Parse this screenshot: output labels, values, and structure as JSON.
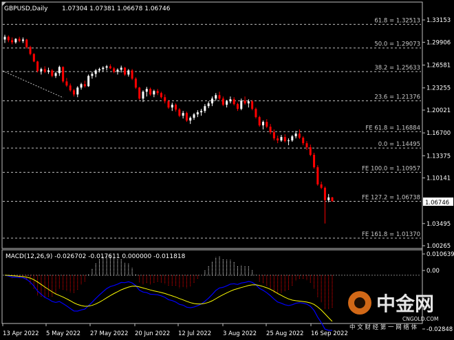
{
  "header": {
    "symbol": "GBPUSD,Daily",
    "ohlc": "1.07304 1.07381 1.06678 1.06746"
  },
  "price_axis": {
    "ticks": [
      "1.33153",
      "1.29906",
      "1.26581",
      "1.23255",
      "1.20021",
      "1.16700",
      "1.13375",
      "1.10141",
      "1.06746",
      "1.03495",
      "1.00265"
    ],
    "current": "1.06746"
  },
  "fib_levels": [
    {
      "label": "61.8 = 1.32513",
      "value": 1.32513
    },
    {
      "label": "50.0 = 1.29073",
      "value": 1.29073
    },
    {
      "label": "38.2 = 1.25633",
      "value": 1.25633
    },
    {
      "label": "23.6 = 1.21376",
      "value": 1.21376
    },
    {
      "label": "FE 61.8 = 1.16884",
      "value": 1.16884
    },
    {
      "label": "0.0 = 1.14495",
      "value": 1.14495
    },
    {
      "label": "FE 100.0 = 1.10957",
      "value": 1.10957
    },
    {
      "label": "FE 127.2 = 1.06738",
      "value": 1.06738
    },
    {
      "label": "FE 161.8 = 1.01370",
      "value": 1.0137
    }
  ],
  "macd": {
    "title": "MACD(12,26,9) -0.026702 -0.017611 0.000000 -0.011818",
    "axis_ticks": [
      "0.010639",
      "0.00",
      "-0.02848"
    ]
  },
  "time_axis": [
    "13 Apr 2022",
    "5 May 2022",
    "27 May 2022",
    "20 Jun 2022",
    "12 Jul 2022",
    "3 Aug 2022",
    "25 Aug 2022",
    "16 Sep 2022"
  ],
  "watermark": {
    "cn": "中金网",
    "url": "CNGOLD.COM",
    "sub": "中 文 财 经 第 一 网 络 体"
  },
  "colors": {
    "bull": "#ffffff",
    "bear": "#ff0000",
    "macd_line": "#0000ff",
    "signal_line": "#ffff00",
    "hist_pos": "#ffffff",
    "hist_neg": "#ff0000",
    "grid_dashed": "#c0c0c0"
  },
  "chart_data": {
    "type": "candlestick",
    "symbol": "GBPUSD",
    "timeframe": "Daily",
    "ylim": [
      1.00265,
      1.33153
    ],
    "x_labels": [
      "13 Apr 2022",
      "5 May 2022",
      "27 May 2022",
      "20 Jun 2022",
      "12 Jul 2022",
      "3 Aug 2022",
      "25 Aug 2022",
      "16 Sep 2022"
    ],
    "ohlc": [
      [
        1.303,
        1.31,
        1.298,
        1.307
      ],
      [
        1.307,
        1.309,
        1.299,
        1.302
      ],
      [
        1.302,
        1.306,
        1.296,
        1.299
      ],
      [
        1.299,
        1.305,
        1.297,
        1.304
      ],
      [
        1.304,
        1.307,
        1.299,
        1.301
      ],
      [
        1.301,
        1.306,
        1.298,
        1.303
      ],
      [
        1.303,
        1.304,
        1.29,
        1.292
      ],
      [
        1.292,
        1.294,
        1.28,
        1.282
      ],
      [
        1.282,
        1.283,
        1.27,
        1.271
      ],
      [
        1.271,
        1.272,
        1.255,
        1.257
      ],
      [
        1.257,
        1.262,
        1.252,
        1.26
      ],
      [
        1.26,
        1.264,
        1.254,
        1.256
      ],
      [
        1.256,
        1.262,
        1.253,
        1.258
      ],
      [
        1.258,
        1.26,
        1.248,
        1.25
      ],
      [
        1.25,
        1.256,
        1.247,
        1.254
      ],
      [
        1.254,
        1.265,
        1.25,
        1.263
      ],
      [
        1.263,
        1.264,
        1.24,
        1.242
      ],
      [
        1.242,
        1.247,
        1.234,
        1.236
      ],
      [
        1.236,
        1.239,
        1.227,
        1.229
      ],
      [
        1.229,
        1.231,
        1.22,
        1.223
      ],
      [
        1.223,
        1.235,
        1.219,
        1.233
      ],
      [
        1.233,
        1.24,
        1.23,
        1.238
      ],
      [
        1.238,
        1.243,
        1.233,
        1.235
      ],
      [
        1.235,
        1.252,
        1.234,
        1.25
      ],
      [
        1.25,
        1.256,
        1.246,
        1.253
      ],
      [
        1.253,
        1.26,
        1.248,
        1.258
      ],
      [
        1.258,
        1.262,
        1.255,
        1.26
      ],
      [
        1.26,
        1.264,
        1.256,
        1.262
      ],
      [
        1.262,
        1.266,
        1.258,
        1.264
      ],
      [
        1.264,
        1.267,
        1.26,
        1.261
      ],
      [
        1.261,
        1.263,
        1.254,
        1.256
      ],
      [
        1.256,
        1.261,
        1.252,
        1.259
      ],
      [
        1.259,
        1.265,
        1.255,
        1.262
      ],
      [
        1.262,
        1.263,
        1.25,
        1.252
      ],
      [
        1.252,
        1.26,
        1.249,
        1.258
      ],
      [
        1.258,
        1.26,
        1.244,
        1.246
      ],
      [
        1.246,
        1.248,
        1.231,
        1.233
      ],
      [
        1.233,
        1.234,
        1.215,
        1.217
      ],
      [
        1.217,
        1.229,
        1.212,
        1.227
      ],
      [
        1.227,
        1.234,
        1.22,
        1.231
      ],
      [
        1.231,
        1.233,
        1.221,
        1.223
      ],
      [
        1.223,
        1.23,
        1.219,
        1.228
      ],
      [
        1.228,
        1.231,
        1.222,
        1.225
      ],
      [
        1.225,
        1.227,
        1.217,
        1.219
      ],
      [
        1.219,
        1.223,
        1.21,
        1.213
      ],
      [
        1.213,
        1.215,
        1.202,
        1.204
      ],
      [
        1.204,
        1.211,
        1.199,
        1.208
      ],
      [
        1.208,
        1.21,
        1.198,
        1.201
      ],
      [
        1.201,
        1.203,
        1.19,
        1.192
      ],
      [
        1.192,
        1.199,
        1.188,
        1.196
      ],
      [
        1.196,
        1.198,
        1.183,
        1.185
      ],
      [
        1.185,
        1.191,
        1.18,
        1.189
      ],
      [
        1.189,
        1.196,
        1.186,
        1.194
      ],
      [
        1.194,
        1.2,
        1.19,
        1.197
      ],
      [
        1.197,
        1.202,
        1.192,
        1.199
      ],
      [
        1.199,
        1.209,
        1.196,
        1.206
      ],
      [
        1.206,
        1.213,
        1.203,
        1.21
      ],
      [
        1.21,
        1.22,
        1.206,
        1.217
      ],
      [
        1.217,
        1.225,
        1.214,
        1.222
      ],
      [
        1.222,
        1.227,
        1.215,
        1.217
      ],
      [
        1.217,
        1.22,
        1.206,
        1.208
      ],
      [
        1.208,
        1.215,
        1.204,
        1.213
      ],
      [
        1.213,
        1.22,
        1.21,
        1.216
      ],
      [
        1.216,
        1.219,
        1.207,
        1.209
      ],
      [
        1.209,
        1.211,
        1.199,
        1.202
      ],
      [
        1.202,
        1.217,
        1.2,
        1.214
      ],
      [
        1.214,
        1.22,
        1.208,
        1.21
      ],
      [
        1.21,
        1.216,
        1.204,
        1.213
      ],
      [
        1.213,
        1.215,
        1.2,
        1.202
      ],
      [
        1.202,
        1.204,
        1.188,
        1.19
      ],
      [
        1.19,
        1.192,
        1.176,
        1.178
      ],
      [
        1.178,
        1.185,
        1.172,
        1.183
      ],
      [
        1.183,
        1.187,
        1.174,
        1.176
      ],
      [
        1.176,
        1.18,
        1.165,
        1.168
      ],
      [
        1.168,
        1.172,
        1.156,
        1.159
      ],
      [
        1.159,
        1.163,
        1.152,
        1.156
      ],
      [
        1.156,
        1.164,
        1.154,
        1.161
      ],
      [
        1.161,
        1.165,
        1.153,
        1.155
      ],
      [
        1.155,
        1.159,
        1.149,
        1.156
      ],
      [
        1.156,
        1.164,
        1.154,
        1.162
      ],
      [
        1.162,
        1.17,
        1.159,
        1.166
      ],
      [
        1.166,
        1.172,
        1.158,
        1.16
      ],
      [
        1.16,
        1.162,
        1.149,
        1.152
      ],
      [
        1.152,
        1.155,
        1.142,
        1.146
      ],
      [
        1.146,
        1.15,
        1.133,
        1.135
      ],
      [
        1.135,
        1.138,
        1.115,
        1.117
      ],
      [
        1.117,
        1.12,
        1.09,
        1.092
      ],
      [
        1.092,
        1.096,
        1.085,
        1.087
      ],
      [
        1.087,
        1.089,
        1.035,
        1.069
      ],
      [
        1.069,
        1.078,
        1.066,
        1.073
      ],
      [
        1.073,
        1.0738,
        1.0668,
        1.0675
      ]
    ],
    "fib_levels": [
      1.32513,
      1.29073,
      1.25633,
      1.21376,
      1.16884,
      1.14495,
      1.10957,
      1.06738,
      1.0137
    ],
    "macd_params": "12,26,9",
    "macd_ylim": [
      -0.02848,
      0.010639
    ]
  }
}
